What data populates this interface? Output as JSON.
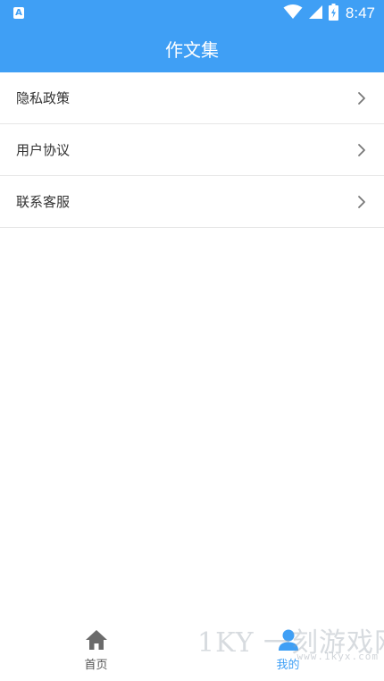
{
  "status_bar": {
    "app_icon_letter": "A",
    "time": "8:47"
  },
  "app_bar": {
    "title": "作文集"
  },
  "menu": {
    "items": [
      {
        "label": "隐私政策"
      },
      {
        "label": "用户协议"
      },
      {
        "label": "联系客服"
      }
    ]
  },
  "tab_bar": {
    "home_label": "首页",
    "mine_label": "我的",
    "active_tab": "我的"
  },
  "watermark": {
    "main": "1KY 一刻游戏网",
    "url": "www.1kyx.com"
  },
  "colors": {
    "primary": "#3f9ff5",
    "text": "#333333",
    "divider": "#e6e6e6",
    "inactive_tab": "#555555"
  },
  "icons": {
    "status": [
      "wifi-icon",
      "signal-icon",
      "battery-charging-icon"
    ],
    "menu_chevron": "chevron-right-icon",
    "home": "home-icon",
    "mine": "user-icon"
  }
}
